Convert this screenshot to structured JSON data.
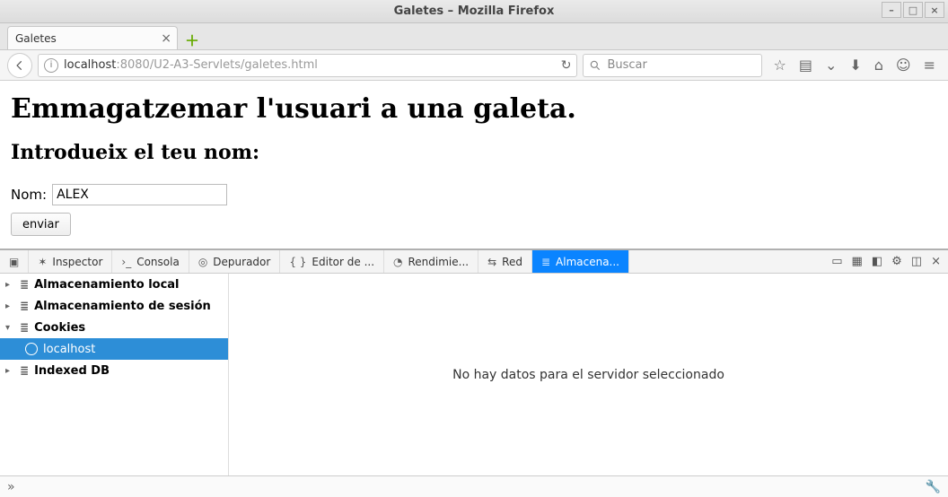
{
  "window": {
    "title": "Galetes – Mozilla Firefox"
  },
  "tabs": {
    "items": [
      {
        "label": "Galetes"
      }
    ]
  },
  "urlbar": {
    "host_dim": "localhost",
    "port_dim": ":8080",
    "path": "/U2-A3-Servlets/galetes.html"
  },
  "search": {
    "placeholder": "Buscar"
  },
  "page": {
    "h1": "Emmagatzemar l'usuari a una galeta.",
    "h2": "Introdueix el teu nom:",
    "nom_label": "Nom:",
    "nom_value": "ALEX",
    "submit_label": "enviar"
  },
  "devtools": {
    "tabs": {
      "inspector": "Inspector",
      "consola": "Consola",
      "depurador": "Depurador",
      "editor": "Editor de ...",
      "rendimie": "Rendimie...",
      "red": "Red",
      "almacena": "Almacena..."
    },
    "side": {
      "local": "Almacenamiento local",
      "session": "Almacenamiento de sesión",
      "cookies": "Cookies",
      "cookies_host": "localhost",
      "indexed": "Indexed DB"
    },
    "main_empty": "No hay datos para el servidor seleccionado"
  }
}
